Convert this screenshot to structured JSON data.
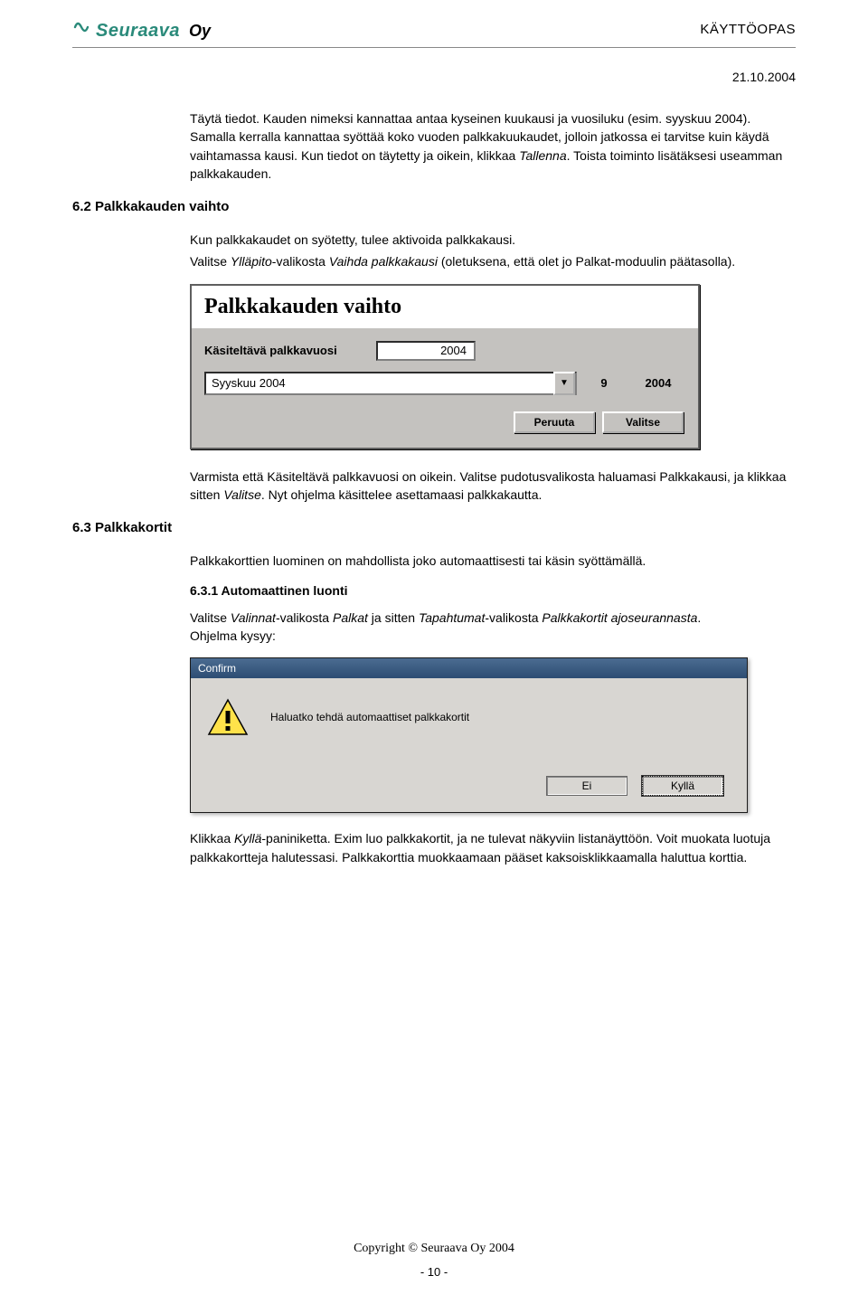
{
  "header": {
    "brand_name": "Seuraava",
    "brand_suffix": "Oy",
    "guide_title": "KÄYTTÖOPAS",
    "date": "21.10.2004"
  },
  "body": {
    "p1a": "Täytä tiedot. Kauden nimeksi kannattaa antaa kyseinen kuukausi ja vuosiluku (esim. syyskuu 2004). Samalla kerralla kannattaa syöttää koko vuoden palkkakuukaudet, jolloin jatkossa ei tarvitse kuin käydä vaihtamassa kausi. Kun tiedot on täytetty ja oikein, klikkaa ",
    "p1_em": "Tallenna",
    "p1b": ". Toista toiminto lisätäksesi useamman palkkakauden.",
    "sec62": "6.2 Palkkakauden vaihto",
    "p2a": "Kun palkkakaudet on syötetty, tulee aktivoida palkkakausi.",
    "p2b_a": "Valitse ",
    "p2b_em1": "Ylläpito",
    "p2b_b": "-valikosta ",
    "p2b_em2": "Vaihda palkkakausi",
    "p2b_c": " (oletuksena, että olet jo Palkat-moduulin päätasolla).",
    "p3a": "Varmista että Käsiteltävä palkkavuosi on oikein. Valitse pudotusvalikosta haluamasi Palkkakausi, ja klikkaa sitten ",
    "p3_em": "Valitse",
    "p3b": ". Nyt ohjelma käsittelee asettamaasi palkkakautta.",
    "sec63": "6.3 Palkkakortit",
    "p4": "Palkkakorttien luominen on mahdollista joko automaattisesti tai käsin syöttämällä.",
    "sec631": "6.3.1 Automaattinen luonti",
    "p5a": "Valitse ",
    "p5_em1": "Valinnat",
    "p5b": "-valikosta ",
    "p5_em2": "Palkat",
    "p5c": " ja sitten ",
    "p5_em3": "Tapahtumat",
    "p5d": "-valikosta ",
    "p5_em4": "Palkkakortit ajoseurannasta",
    "p5e": ".",
    "p5f": "Ohjelma kysyy:",
    "p6a": "Klikkaa ",
    "p6_em": "Kyllä",
    "p6b": "-paniniketta. Exim luo palkkakortit, ja ne tulevat näkyviin listanäyttöön. Voit muokata luotuja palkkakortteja halutessasi. Palkkakorttia muokkaamaan pääset kaksoisklikkaamalla haluttua korttia."
  },
  "dialog1": {
    "title": "Palkkakauden vaihto",
    "year_label": "Käsiteltävä palkkavuosi",
    "year_value": "2004",
    "combo_value": "Syyskuu 2004",
    "month_num": "9",
    "year_num": "2004",
    "btn_cancel": "Peruuta",
    "btn_ok": "Valitse"
  },
  "dialog2": {
    "title": "Confirm",
    "message": "Haluatko tehdä automaattiset palkkakortit",
    "btn_no": "Ei",
    "btn_yes": "Kyllä"
  },
  "footer": {
    "copyright": "Copyright © Seuraava Oy 2004",
    "page": "- 10 -"
  }
}
